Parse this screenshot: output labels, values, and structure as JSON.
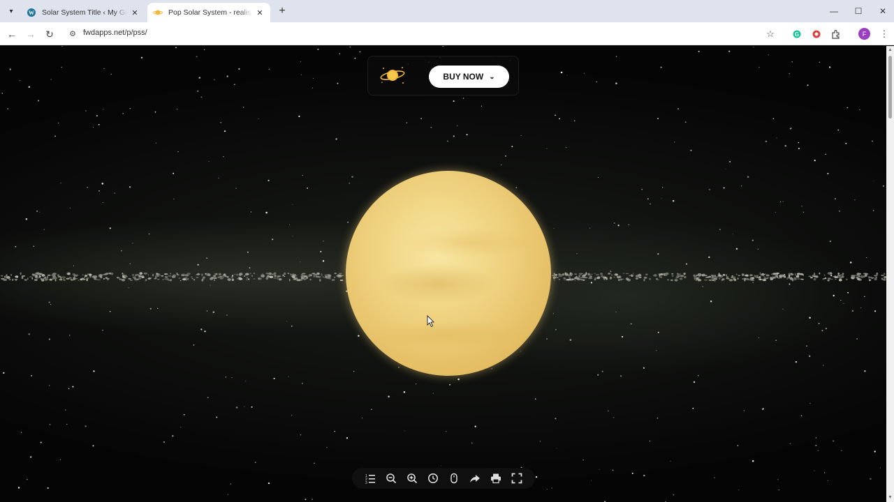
{
  "browser": {
    "tabs": [
      {
        "title": "Solar System Title ‹ My Great Bl",
        "active": false
      },
      {
        "title": "Pop Solar System - realistic sola",
        "active": true
      }
    ],
    "url": "fwdapps.net/p/pss/",
    "profile_initial": "F"
  },
  "page": {
    "buy_button_label": "BUY NOW"
  },
  "colors": {
    "planet": "#efd27f",
    "background": "#0b0c0b",
    "button_bg": "#ffffff"
  },
  "controls": [
    {
      "name": "categories-icon"
    },
    {
      "name": "zoom-out-icon"
    },
    {
      "name": "zoom-in-icon"
    },
    {
      "name": "clock-icon"
    },
    {
      "name": "mouse-icon"
    },
    {
      "name": "share-icon"
    },
    {
      "name": "print-icon"
    },
    {
      "name": "fullscreen-icon"
    }
  ]
}
